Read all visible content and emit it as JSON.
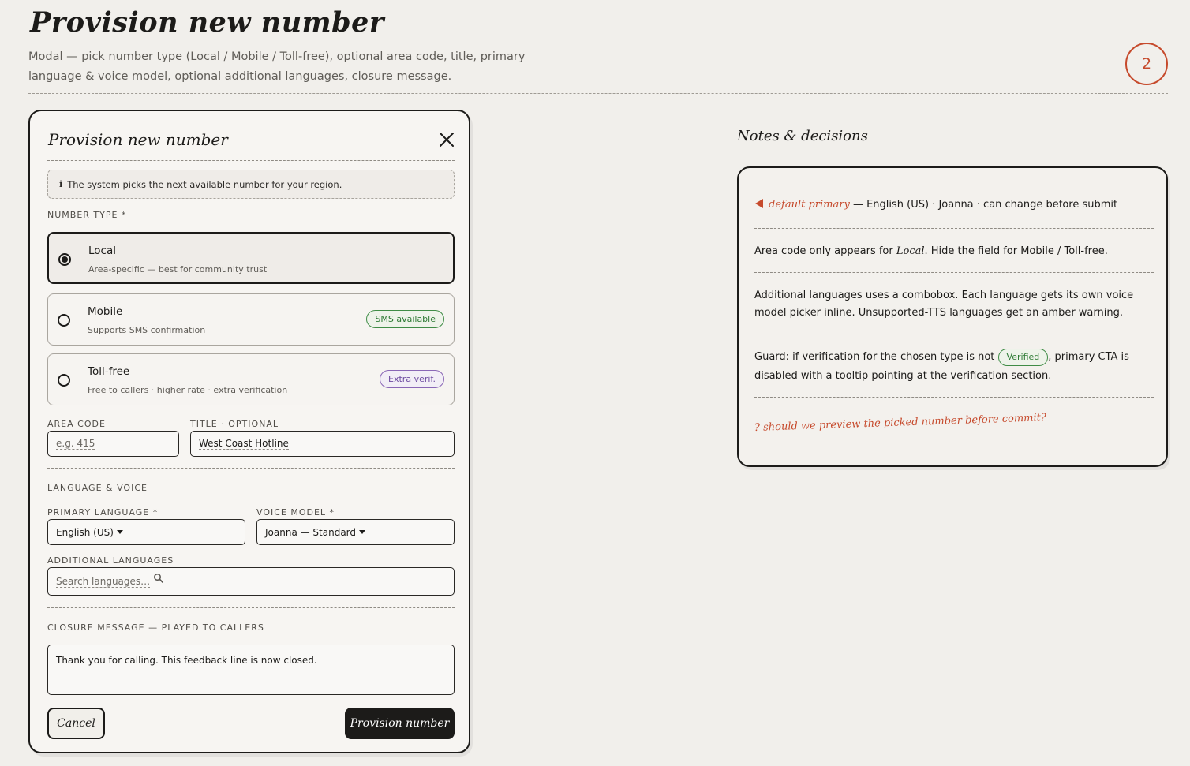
{
  "page": {
    "title": "Provision new number",
    "subtitle": "Modal — pick number type (Local / Mobile / Toll-free), optional area code, title, primary language & voice model, optional additional languages, closure message.",
    "step": "2"
  },
  "modal": {
    "title": "Provision new number",
    "info_note": "The system picks the next available number for your region.",
    "number_type_label": "NUMBER TYPE *",
    "options": [
      {
        "title": "Local",
        "desc": "Area-specific — best for community trust",
        "selected": true,
        "badge": ""
      },
      {
        "title": "Mobile",
        "desc": "Supports SMS confirmation",
        "selected": false,
        "badge": "SMS available"
      },
      {
        "title": "Toll-free",
        "desc": "Free to callers · higher rate · extra verification",
        "selected": false,
        "badge": "Extra verif."
      }
    ],
    "area_code_label": "AREA CODE",
    "area_code_placeholder": "e.g. 415",
    "title_label": "TITLE · OPTIONAL",
    "title_value": "West Coast Hotline",
    "language_section_label": "LANGUAGE & VOICE",
    "primary_language_label": "PRIMARY LANGUAGE *",
    "primary_language_value": "English (US)",
    "voice_model_label": "VOICE MODEL *",
    "voice_model_value": "Joanna — Standard",
    "additional_languages_label": "ADDITIONAL LANGUAGES",
    "additional_languages_placeholder": "Search languages…",
    "closure_label": "CLOSURE MESSAGE — PLAYED TO CALLERS",
    "closure_value": "Thank you for calling. This feedback line is now closed.",
    "cancel_label": "Cancel",
    "submit_label": "Provision number"
  },
  "notes": {
    "title": "Notes & decisions",
    "default_label": "default primary",
    "default_text": "— English (US) · Joanna · can change before submit",
    "area_pre": "Area code only appears for ",
    "area_em": "Local",
    "area_post": ". Hide the field for Mobile / Toll-free.",
    "combobox": "Additional languages uses a combobox. Each language gets its own voice model picker inline. Unsupported-TTS languages get an amber warning.",
    "guard_pre": "Guard: if verification for the chosen type is not",
    "guard_pill": "Verified",
    "guard_post": ", primary CTA is disabled with a tooltip pointing at the verification section.",
    "question": "? should we preview the picked number before commit?"
  },
  "colors": {
    "accent_red": "#c64a2c",
    "ink": "#1c1b19",
    "green": "#2d7a34",
    "purple": "#6d4aa0",
    "background": "#f1efeb"
  },
  "icons": {
    "close": "close-icon",
    "info": "info-icon",
    "search": "search-icon",
    "dropdown": "chevron-down-icon",
    "pointer": "triangle-left-icon"
  }
}
